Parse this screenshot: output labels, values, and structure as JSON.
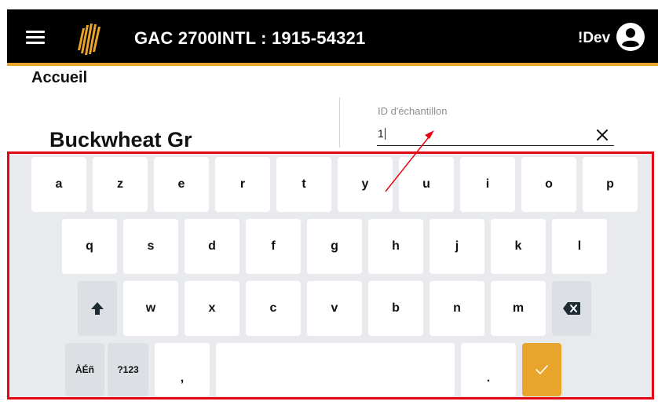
{
  "header": {
    "title": "GAC 2700INTL : 1915-54321",
    "user_label": "!Dev",
    "accent_color": "#e9a52b",
    "icons": [
      "menu-icon",
      "brand-logo-icon",
      "account-circle-icon"
    ]
  },
  "breadcrumb": "Accueil",
  "product": {
    "name": "Buckwheat Gr"
  },
  "sample_field": {
    "label": "ID d'échantillon",
    "value": "1",
    "clear_icon": "close-icon"
  },
  "keyboard": {
    "row1": [
      "a",
      "z",
      "e",
      "r",
      "t",
      "y",
      "u",
      "i",
      "o",
      "p"
    ],
    "row2": [
      "q",
      "s",
      "d",
      "f",
      "g",
      "h",
      "j",
      "k",
      "l"
    ],
    "row3": [
      "w",
      "x",
      "c",
      "v",
      "b",
      "n",
      "m"
    ],
    "row4": {
      "accents": "ÀÉñ",
      "symbols": "?123",
      "comma": ",",
      "period": "."
    },
    "shift_icon": "shift-up-arrow-icon",
    "backspace_icon": "backspace-icon",
    "enter_icon": "checkmark-icon",
    "highlight_color": "#e30613"
  }
}
